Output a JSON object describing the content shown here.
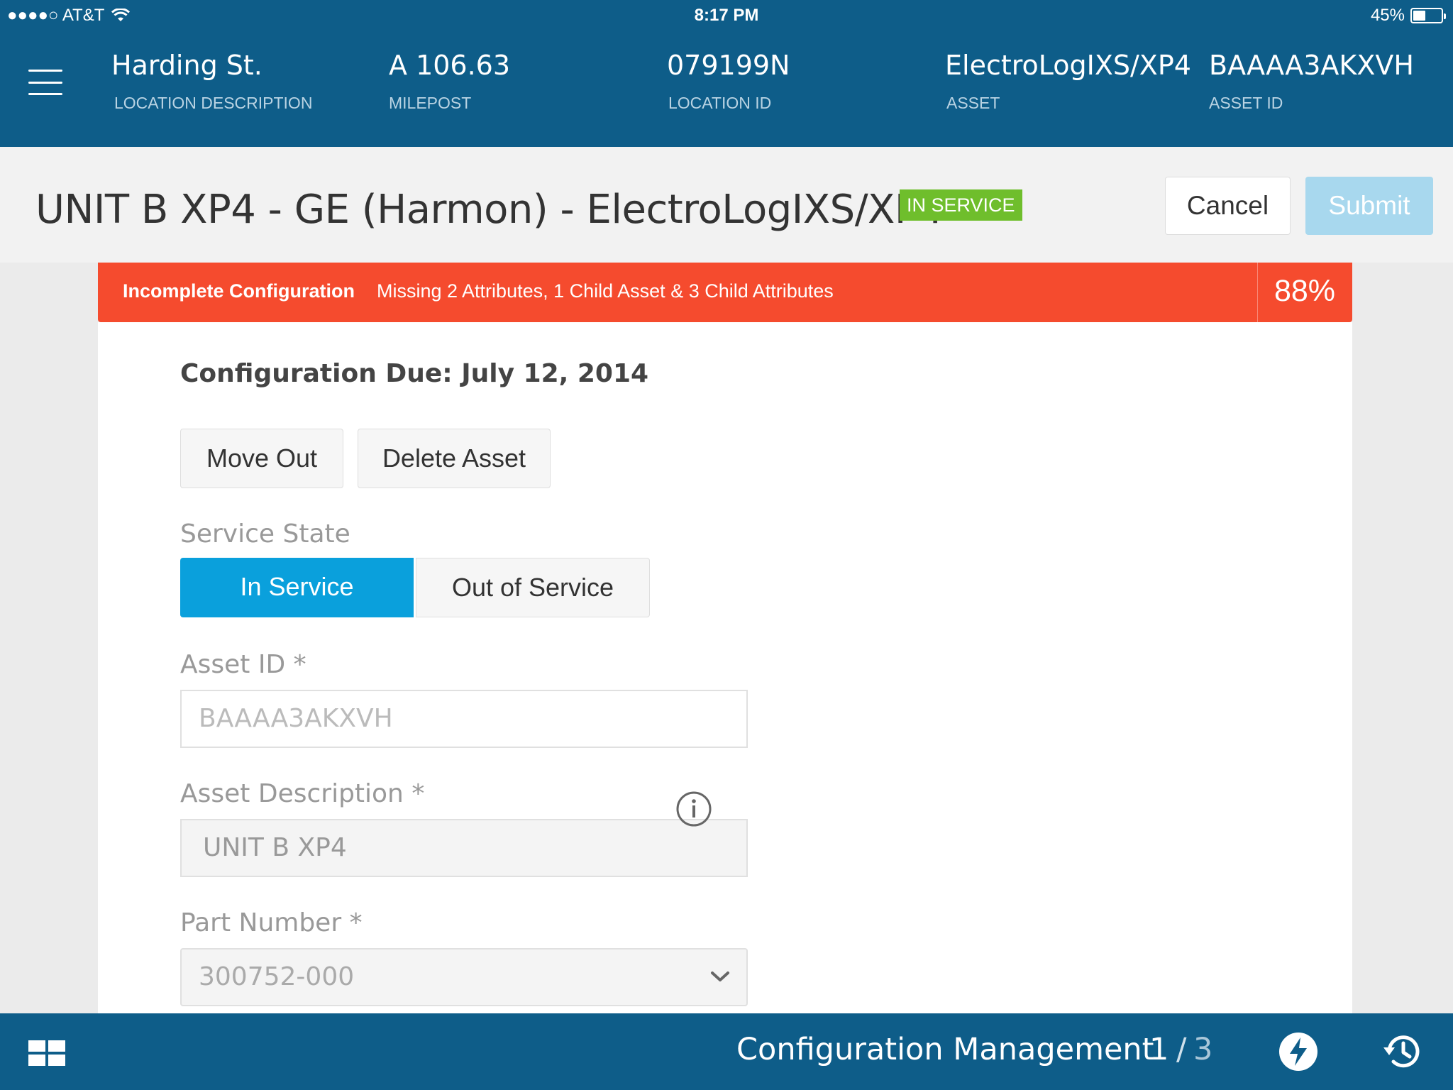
{
  "status_bar": {
    "carrier": "●●●●○ AT&T",
    "time": "8:17 PM",
    "battery_pct": "45%",
    "battery_level": 0.45
  },
  "header": {
    "location_description": {
      "value": "Harding St.",
      "label": "LOCATION DESCRIPTION"
    },
    "milepost": {
      "value": "A 106.63",
      "label": "MILEPOST"
    },
    "location_id": {
      "value": "079199N",
      "label": "LOCATION ID"
    },
    "asset": {
      "value": "ElectroLogIXS/XP4",
      "label": "ASSET"
    },
    "asset_id": {
      "value": "BAAAA3AKXVH",
      "label": "ASSET ID"
    }
  },
  "title_bar": {
    "title": "UNIT B XP4 - GE (Harmon) - ElectroLogIXS/XP4",
    "status_badge": "IN SERVICE",
    "cancel_label": "Cancel",
    "submit_label": "Submit"
  },
  "alert": {
    "title": "Incomplete Configuration",
    "message": "Missing 2 Attributes, 1 Child Asset & 3 Child Attributes",
    "percent": "88%"
  },
  "form": {
    "due": "Configuration Due: July 12, 2014",
    "move_out_label": "Move Out",
    "delete_asset_label": "Delete Asset",
    "service_state_label": "Service State",
    "service_options": [
      "In Service",
      "Out of Service"
    ],
    "asset_id_label": "Asset ID *",
    "asset_id_placeholder": "BAAAA3AKXVH",
    "asset_description_label": "Asset Description *",
    "asset_description_value": "UNIT B XP4",
    "part_number_label": "Part Number *",
    "part_number_value": "300752-000"
  },
  "bottom_bar": {
    "app_name": "Configuration Management",
    "page_current": "1",
    "page_separator": "/",
    "page_total": "3"
  },
  "colors": {
    "header_blue": "#0e5d89",
    "alert_red": "#f54b2e",
    "active_blue": "#0aa0dc",
    "badge_green": "#6fbe2c",
    "submit_disabled": "#a8d8ee"
  },
  "icons": [
    "wifi-icon",
    "battery-icon",
    "hamburger-icon",
    "info-icon",
    "chevron-down-icon",
    "grid-icon",
    "bolt-icon",
    "history-icon"
  ]
}
